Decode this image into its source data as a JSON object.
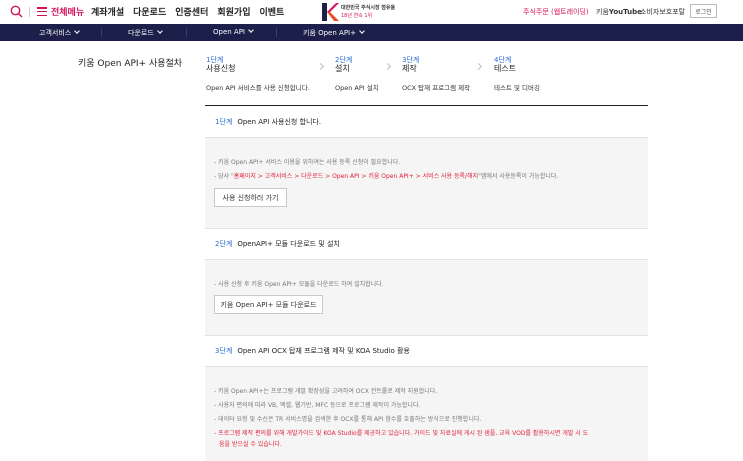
{
  "header": {
    "menu_all": "전체메뉴",
    "nav": [
      "계좌개설",
      "다운로드",
      "인증센터",
      "회원가입",
      "이벤트"
    ],
    "logo_line1": "대한민국 주식시장 점유율",
    "logo_line2": "18년 연속 1위",
    "order_link": "주식주문 (웹트레이딩)",
    "youtube_prefix": "키움",
    "youtube_brand": "YouTube",
    "consumer_link": "소비자보호포탈",
    "login": "로그인"
  },
  "subnav": [
    "고객서비스",
    "다운로드",
    "Open API",
    "키움 Open API+"
  ],
  "page": {
    "title": "키움 Open API+ 사용절차",
    "steps": [
      {
        "num": "1단계",
        "name": "사용신청",
        "desc": "Open API 서비스를 사용 신청합니다."
      },
      {
        "num": "2단계",
        "name": "설치",
        "desc": "Open API 설치"
      },
      {
        "num": "3단계",
        "name": "제작",
        "desc": "OCX 탑재 프로그램 제작"
      },
      {
        "num": "4단계",
        "name": "테스트",
        "desc": "테스트 및 디버깅"
      }
    ]
  },
  "sections": {
    "s1": {
      "num": "1단계",
      "title": "Open API 사용신청 합니다.",
      "bullet1": "- 키움 Open API+ 서비스 이용을 위하여는 사용 등록 신청이 필요합니다.",
      "bullet2_pre": "- 당사 \"",
      "bullet2_hl": "홈페이지 > 고객서비스 > 다운로드 > Open API > 키움 Open API+ > 서비스 사용 등록/해지",
      "bullet2_post": "\"맵에서 사용등록이 가능합니다.",
      "button": "사용 신청하러 가기"
    },
    "s2": {
      "num": "2단계",
      "title": "OpenAPI+ 모듈 다운로드 및 설치",
      "bullet1": "- 사용 신청 후 키움 Open API+ 모듈을 다운로드 하여 설치합니다.",
      "button": "키움 Open API+ 모듈 다운로드"
    },
    "s3": {
      "num": "3단계",
      "title": "Open API OCX 탑재 프로그램 제작 및 KOA Studio 활용",
      "bullet1": "- 키움 Open API+는 프로그램 개발 확장성을 고려하여 OCX 컨트롤로 제작 지원합니다.",
      "bullet2": "- 사용자 편의에 따라 VB, 엑셀, 웹기반, MFC 등으로 프로그램 제작이 가능합니다.",
      "bullet3": "- 데이터 요청 및 수신은 TR 서비스명을 검색한 후 OCX를 통해 API 함수를 호출하는 방식으로 진행합니다.",
      "bullet4_line1": "- 프로그램 제작 편의를 위해 개발가이드 및 KOA Studio를 제공하고 있습니다. 가이드 및 자료실에 게시 된 샘플, 교육 VOD를 활용하시면 개발 시 도",
      "bullet4_line2": "움을 받으실 수 있습니다."
    }
  },
  "colors": {
    "brand": "#d4145a",
    "navy": "#1c1f4a",
    "step_blue": "#2a6fd1",
    "alert_red": "#e0223a"
  },
  "icons": [
    "search-icon",
    "hamburger-icon",
    "logo-k-icon",
    "chevron-down-icon",
    "chevron-right-icon"
  ]
}
